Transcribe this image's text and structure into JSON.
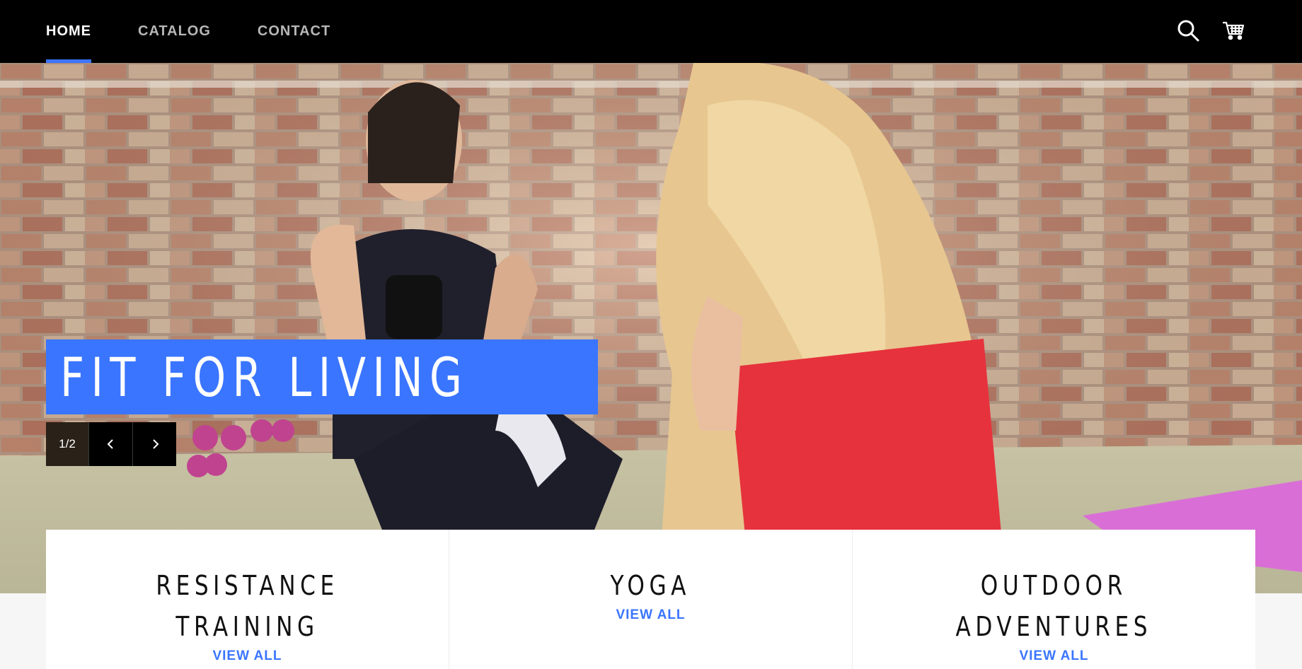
{
  "header": {
    "nav": [
      {
        "label": "HOME",
        "active": true
      },
      {
        "label": "CATALOG",
        "active": false
      },
      {
        "label": "CONTACT",
        "active": false
      }
    ],
    "icons": [
      "search-icon",
      "cart-icon"
    ]
  },
  "hero": {
    "title": "FIT FOR LIVING",
    "slide_counter": "1/2",
    "controls": {
      "prev_icon": "chevron-left-icon",
      "next_icon": "chevron-right-icon"
    }
  },
  "collections": [
    {
      "title": "RESISTANCE\nTRAINING",
      "link": "VIEW ALL"
    },
    {
      "title": "YOGA",
      "link": "VIEW ALL"
    },
    {
      "title": "OUTDOOR\nADVENTURES",
      "link": "VIEW ALL"
    }
  ],
  "colors": {
    "accent": "#3a75ff",
    "header_bg": "#000000",
    "nav_inactive": "#b7b7b7",
    "nav_active": "#ffffff"
  }
}
